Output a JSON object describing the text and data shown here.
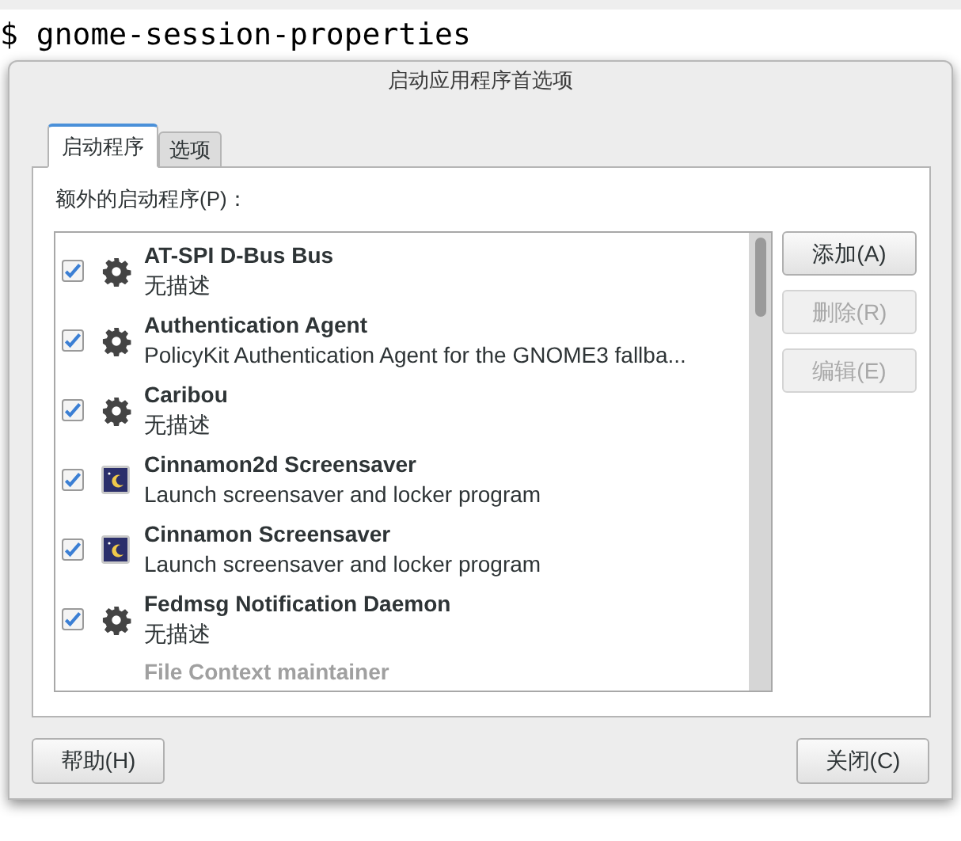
{
  "terminal": {
    "command": "$ gnome-session-properties"
  },
  "window": {
    "title": "启动应用程序首选项"
  },
  "tabs": [
    {
      "label": "启动程序",
      "selected": true
    },
    {
      "label": "选项",
      "selected": false
    }
  ],
  "list_label": "额外的启动程序(P)：",
  "programs": [
    {
      "name": "AT-SPI D-Bus Bus",
      "description": "无描述",
      "checked": true,
      "kind": "gear"
    },
    {
      "name": "Authentication Agent",
      "description": "PolicyKit Authentication Agent for the GNOME3 fallba...",
      "checked": true,
      "kind": "gear"
    },
    {
      "name": "Caribou",
      "description": "无描述",
      "checked": true,
      "kind": "gear"
    },
    {
      "name": "Cinnamon2d Screensaver",
      "description": "Launch screensaver and locker program",
      "checked": true,
      "kind": "screensaver"
    },
    {
      "name": "Cinnamon Screensaver",
      "description": "Launch screensaver and locker program",
      "checked": true,
      "kind": "screensaver"
    },
    {
      "name": "Fedmsg Notification Daemon",
      "description": "无描述",
      "checked": true,
      "kind": "gear"
    },
    {
      "name": "File Context maintainer"
    }
  ],
  "side_buttons": [
    {
      "label": "添加(A)",
      "disabled": false
    },
    {
      "label": "删除(R)",
      "disabled": true
    },
    {
      "label": "编辑(E)",
      "disabled": true
    }
  ],
  "footer_buttons": [
    "帮助(H)",
    "关闭(C)"
  ]
}
